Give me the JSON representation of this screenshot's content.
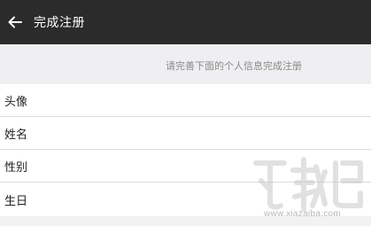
{
  "header": {
    "title": "完成注册",
    "back_icon": "arrow-left-icon"
  },
  "hint": "请完善下面的个人信息完成注册",
  "form": {
    "rows": [
      {
        "label": "头像"
      },
      {
        "label": "姓名"
      },
      {
        "label": "性别"
      },
      {
        "label": "生日"
      }
    ]
  },
  "watermark": {
    "url": "www.xiazaiba.com"
  },
  "colors": {
    "header_bg": "#2b2b2b",
    "page_bg": "#f0f0f0",
    "row_bg": "#ffffff",
    "hint_text": "#8a8a8a"
  }
}
